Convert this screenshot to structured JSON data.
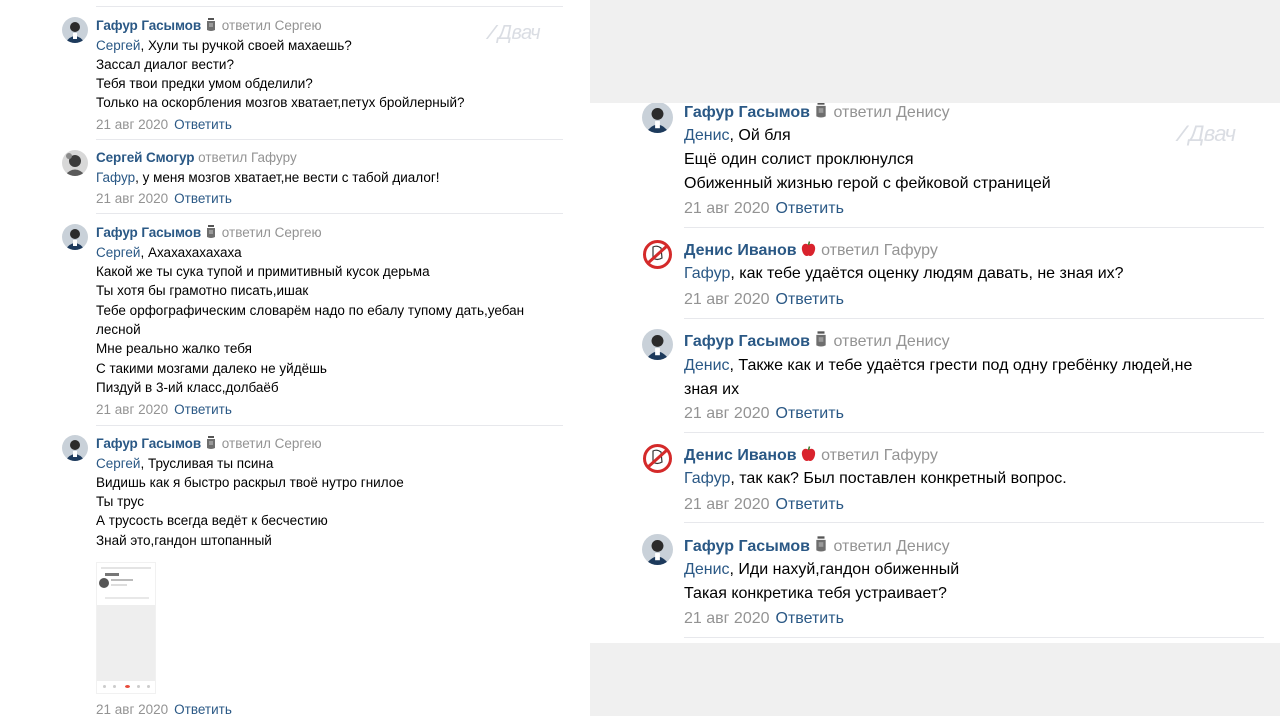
{
  "watermark": "Двач",
  "left_panel": {
    "comments": [
      {
        "author": "Гафур Гасымов",
        "gift_icon": "urn-gift-icon",
        "reply_to": "ответил Сергею",
        "mention": "Сергей",
        "first_rest": ", Хули ты ручкой своей махаешь?",
        "lines": [
          "Зассал диалог вести?",
          "Тебя твои предки умом обделили?",
          "Только на оскорбления мозгов хватает,петух бройлерный?"
        ],
        "date": "21 авг 2020",
        "reply_label": "Ответить"
      },
      {
        "author": "Сергей Смогур",
        "reply_to": "ответил Гафуру",
        "mention": "Гафур",
        "first_rest": ", у меня мозгов хватает,не вести с табой диалог!",
        "lines": [],
        "date": "21 авг 2020",
        "reply_label": "Ответить"
      },
      {
        "author": "Гафур Гасымов",
        "gift_icon": "urn-gift-icon",
        "reply_to": "ответил Сергею",
        "mention": "Сергей",
        "first_rest": ", Ахахахахахаха",
        "lines": [
          "Какой же ты сука тупой и примитивный кусок дерьма",
          "Ты хотя бы грамотно писать,ишак",
          "Тебе орфографическим словарём надо по ебалу тупому дать,уебан",
          "лесной",
          "Мне реально жалко тебя",
          "С такими мозгами далеко не уйдёшь",
          "Пиздуй в 3-ий класс,долбаёб"
        ],
        "date": "21 авг 2020",
        "reply_label": "Ответить"
      },
      {
        "author": "Гафур Гасымов",
        "gift_icon": "urn-gift-icon",
        "reply_to": "ответил Сергею",
        "mention": "Сергей",
        "first_rest": ", Трусливая ты псина",
        "lines": [
          "Видишь как я быстро раскрыл твоё нутро гнилое",
          "Ты трус",
          "А трусость всегда ведёт к бесчестию",
          "Знай это,гандон штопанный"
        ],
        "date": "21 авг 2020",
        "reply_label": "Ответить"
      }
    ]
  },
  "right_panel": {
    "comments": [
      {
        "author": "Гафур Гасымов",
        "gift_icon": "urn-gift-icon",
        "reply_to": "ответил Денису",
        "mention": "Денис",
        "first_rest": ", Ой бля",
        "lines": [
          "Ещё один солист проклюнулся",
          "Обиженный жизнью герой с фейковой страницей"
        ],
        "date": "21 авг 2020",
        "reply_label": "Ответить"
      },
      {
        "author": "Денис Иванов",
        "gift_icon": "apple-gift-icon",
        "reply_to": "ответил Гафуру",
        "mention": "Гафур",
        "first_rest": ", как тебе удаётся оценку людям давать, не зная их?",
        "lines": [],
        "date": "21 авг 2020",
        "reply_label": "Ответить"
      },
      {
        "author": "Гафур Гасымов",
        "gift_icon": "urn-gift-icon",
        "reply_to": "ответил Денису",
        "mention": "Денис",
        "first_rest": ", Также как и тебе удаётся грести под одну гребёнку людей,не",
        "lines": [
          "зная их"
        ],
        "date": "21 авг 2020",
        "reply_label": "Ответить"
      },
      {
        "author": "Денис Иванов",
        "gift_icon": "apple-gift-icon",
        "reply_to": "ответил Гафуру",
        "mention": "Гафур",
        "first_rest": ", так как? Был поставлен конкретный вопрос.",
        "lines": [],
        "date": "21 авг 2020",
        "reply_label": "Ответить"
      },
      {
        "author": "Гафур Гасымов",
        "gift_icon": "urn-gift-icon",
        "reply_to": "ответил Денису",
        "mention": "Денис",
        "first_rest": ", Иди нахуй,гандон обиженный",
        "lines": [
          "Такая конкретика тебя устраивает?"
        ],
        "date": "21 авг 2020",
        "reply_label": "Ответить"
      }
    ]
  },
  "colors": {
    "link": "#2a5885",
    "muted": "#939393",
    "divider": "#e7e8ec",
    "gray_background": "#f0f0f0"
  }
}
